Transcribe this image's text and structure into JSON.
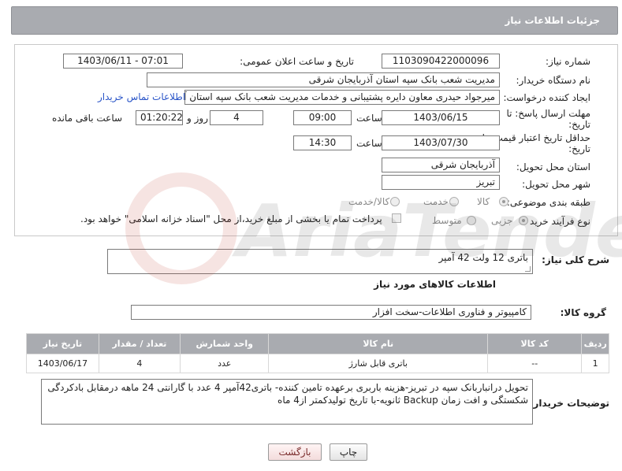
{
  "header": {
    "title": "جزئیات اطلاعات نیاز"
  },
  "form": {
    "need_number": {
      "label": "شماره نیاز:",
      "value": "1103090422000096"
    },
    "announce_datetime": {
      "label": "تاریخ و ساعت اعلان عمومی:",
      "value": "1403/06/11 - 07:01"
    },
    "buyer_org": {
      "label": "نام دستگاه خریدار:",
      "value": "مدیریت شعب بانک سپه استان آذربایجان شرقی"
    },
    "requester": {
      "label": "ایجاد کننده درخواست:",
      "value": "میرجواد حیدری معاون دایره پشتیبانی و خدمات مدیریت شعب بانک سپه استان آ",
      "contact_link": "اطلاعات تماس خریدار"
    },
    "reply_deadline": {
      "label": "مهلت ارسال پاسخ: تا تاریخ:",
      "date": "1403/06/15",
      "time_label": "ساعت",
      "time": "09:00",
      "days": "4",
      "days_label": "روز و",
      "remaining": "01:20:22",
      "remaining_label": "ساعت باقی مانده"
    },
    "price_validity": {
      "label": "حداقل تاریخ اعتبار قیمت: تا تاریخ:",
      "date": "1403/07/30",
      "time_label": "ساعت",
      "time": "14:30"
    },
    "delivery_province": {
      "label": "استان محل تحویل:",
      "value": "آذربایجان شرقی"
    },
    "delivery_city": {
      "label": "شهر محل تحویل:",
      "value": "تبریز"
    },
    "category": {
      "label": "طبقه بندی موضوعی:",
      "options": [
        "کالا",
        "خدمت",
        "کالا/خدمت"
      ],
      "selected": "کالا"
    },
    "process_type": {
      "label": "نوع فرآیند خرید :",
      "options": [
        "جزیی",
        "متوسط"
      ],
      "selected": "جزیی",
      "payment_note": "پرداخت تمام یا بخشی از مبلغ خرید،از محل \"اسناد خزانه اسلامی\" خواهد بود."
    }
  },
  "summary": {
    "label": "شرح کلی نیاز:",
    "value": "باتری 12 ولت 42 آمپر"
  },
  "goods_info": {
    "title": "اطلاعات کالاهای مورد نیاز",
    "group_label": "گروه کالا:",
    "group_value": "کامپیوتر و فناوری اطلاعات-سخت افزار",
    "columns": [
      "ردیف",
      "کد کالا",
      "نام کالا",
      "واحد شمارش",
      "تعداد / مقدار",
      "تاریخ نیاز"
    ],
    "rows": [
      {
        "row": "1",
        "code": "--",
        "name": "باتری قابل شارژ",
        "unit": "عدد",
        "qty": "4",
        "date": "1403/06/17"
      }
    ]
  },
  "buyer_notes": {
    "label": "توضیحات خریدار:",
    "value": "تحویل درانباربانک سپه در تبریز-هزینه باربری برعهده تامین کننده- باتری42آمپر 4 عدد با گارانتی 24 ماهه  درمقابل بادکردگی شکستگی و افت زمان Backup ثانویه-با تاریخ تولیدکمتر از4 ماه"
  },
  "buttons": {
    "print": "چاپ",
    "back": "بازگشت"
  },
  "watermark_text": "AriaTender.neT",
  "colors": {
    "header_bg": "#a9abb0",
    "link": "#2a55c8",
    "watermark": "#c0392b"
  }
}
